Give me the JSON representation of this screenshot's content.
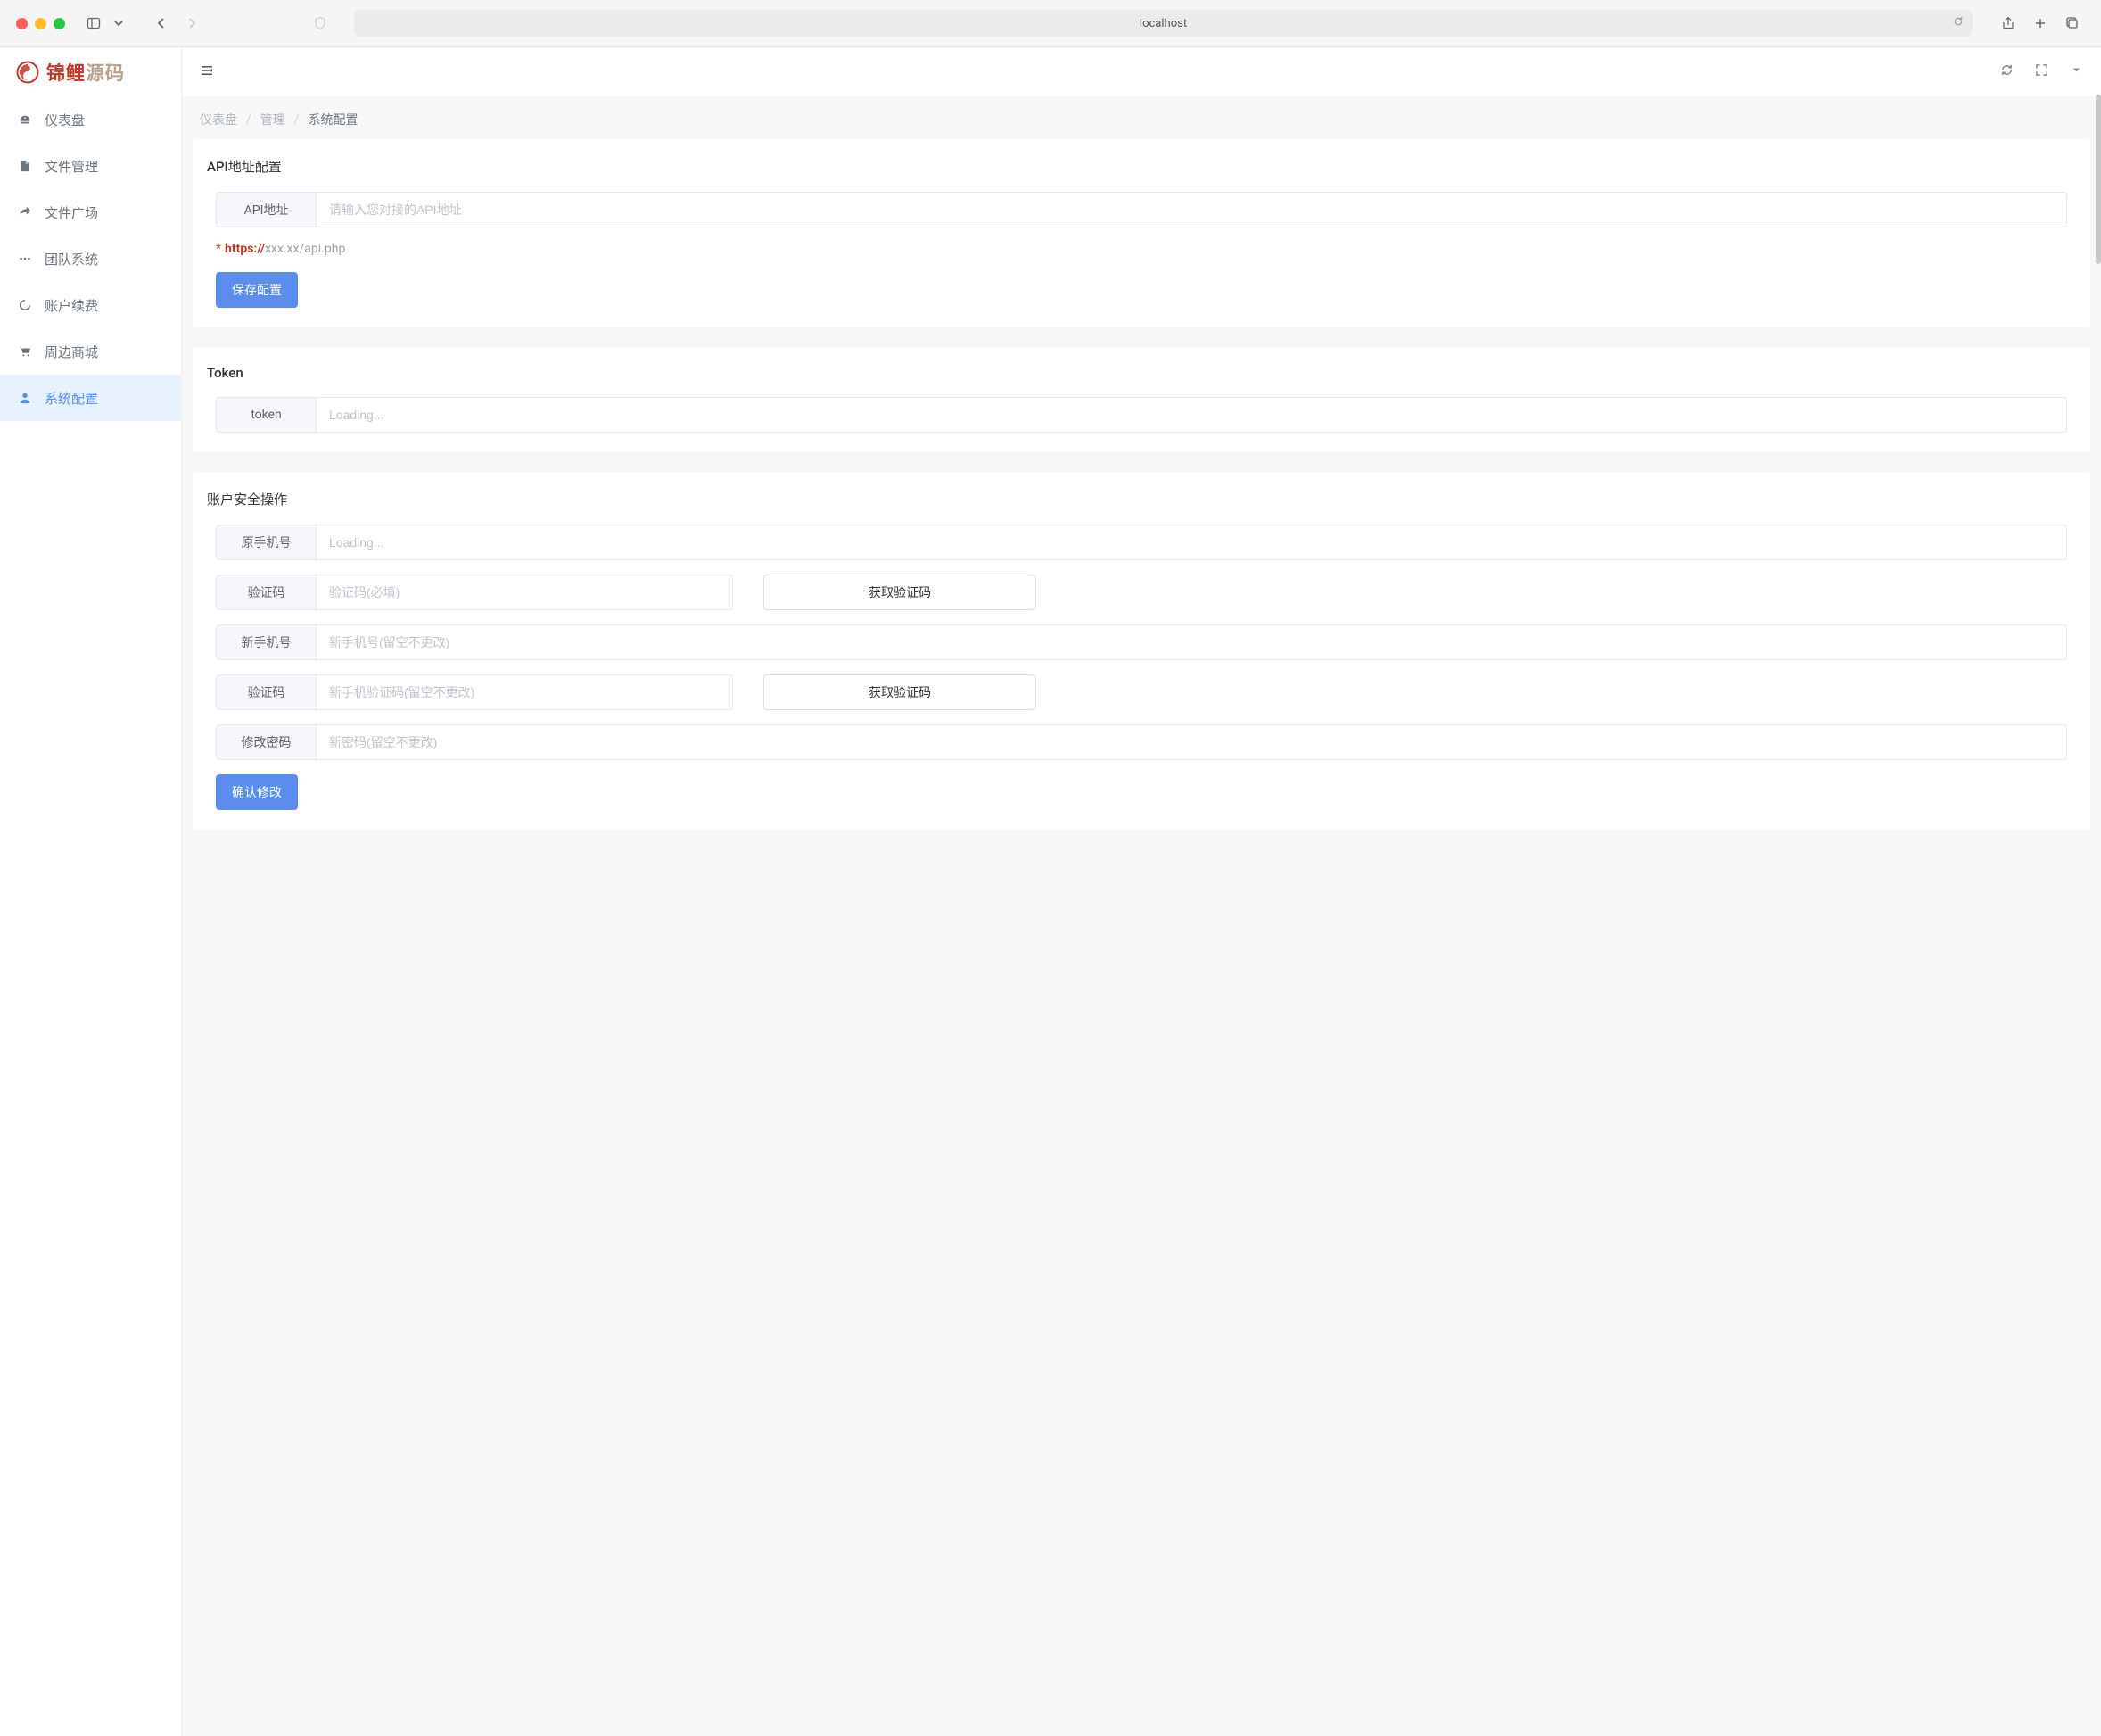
{
  "browser": {
    "url": "localhost"
  },
  "brand": {
    "part1": "锦鲤",
    "part2": "源码"
  },
  "sidebar": {
    "items": [
      {
        "label": "仪表盘"
      },
      {
        "label": "文件管理"
      },
      {
        "label": "文件广场"
      },
      {
        "label": "团队系统"
      },
      {
        "label": "账户续费"
      },
      {
        "label": "周边商城"
      },
      {
        "label": "系统配置"
      }
    ]
  },
  "breadcrumb": {
    "items": [
      "仪表盘",
      "管理",
      "系统配置"
    ]
  },
  "sections": {
    "api": {
      "title": "API地址配置",
      "addon": "API地址",
      "placeholder": "请输入您对接的API地址",
      "hint_star": "*",
      "hint_strong": "https://",
      "hint_rest": "xxx.xx/api.php",
      "save_btn": "保存配置"
    },
    "token": {
      "title": "Token",
      "addon": "token",
      "placeholder": "Loading..."
    },
    "security": {
      "title": "账户安全操作",
      "old_phone_addon": "原手机号",
      "old_phone_placeholder": "Loading...",
      "code1_addon": "验证码",
      "code1_placeholder": "验证码(必填)",
      "get_code1_btn": "获取验证码",
      "new_phone_addon": "新手机号",
      "new_phone_placeholder": "新手机号(留空不更改)",
      "code2_addon": "验证码",
      "code2_placeholder": "新手机验证码(留空不更改)",
      "get_code2_btn": "获取验证码",
      "password_addon": "修改密码",
      "password_placeholder": "新密码(留空不更改)",
      "confirm_btn": "确认修改"
    }
  }
}
